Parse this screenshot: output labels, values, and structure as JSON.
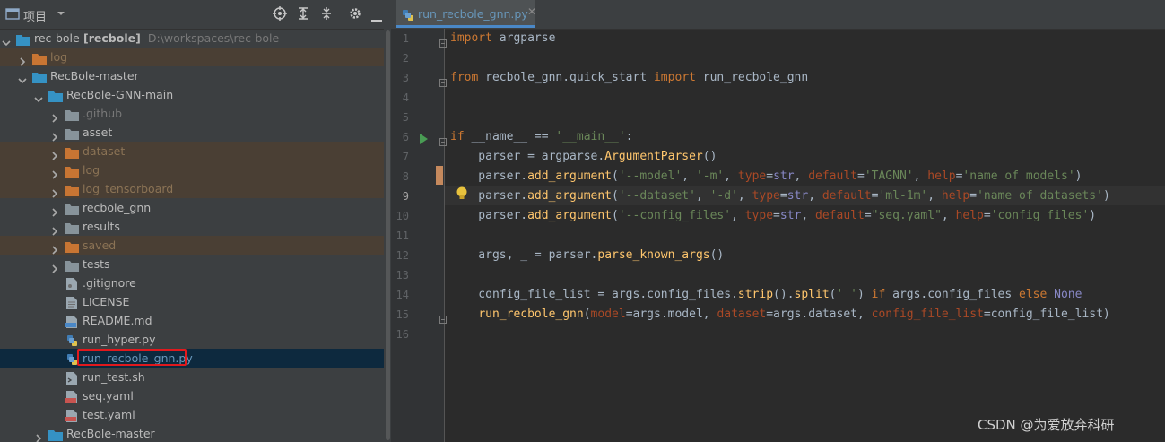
{
  "project_panel": {
    "title": "项目",
    "tree": [
      {
        "label": "rec-bole",
        "bold": "[recbole]",
        "path": "D:\\workspaces\\rec-bole",
        "depth": 0,
        "expanded": true,
        "type": "folder-blue"
      },
      {
        "label": "log",
        "depth": 1,
        "expanded": false,
        "type": "folder-orange",
        "excluded": true
      },
      {
        "label": "RecBole-master",
        "depth": 1,
        "expanded": true,
        "type": "folder-blue"
      },
      {
        "label": "RecBole-GNN-main",
        "depth": 2,
        "expanded": true,
        "type": "folder-blue"
      },
      {
        "label": ".github",
        "depth": 3,
        "expanded": false,
        "type": "folder-gray",
        "muted": true
      },
      {
        "label": "asset",
        "depth": 3,
        "expanded": false,
        "type": "folder-gray"
      },
      {
        "label": "dataset",
        "depth": 3,
        "expanded": false,
        "type": "folder-orange",
        "excluded": true
      },
      {
        "label": "log",
        "depth": 3,
        "expanded": false,
        "type": "folder-orange",
        "excluded": true
      },
      {
        "label": "log_tensorboard",
        "depth": 3,
        "expanded": false,
        "type": "folder-orange",
        "excluded": true
      },
      {
        "label": "recbole_gnn",
        "depth": 3,
        "expanded": false,
        "type": "folder-gray"
      },
      {
        "label": "results",
        "depth": 3,
        "expanded": false,
        "type": "folder-gray"
      },
      {
        "label": "saved",
        "depth": 3,
        "expanded": false,
        "type": "folder-orange",
        "excluded": true
      },
      {
        "label": "tests",
        "depth": 3,
        "expanded": false,
        "type": "folder-gray"
      },
      {
        "label": ".gitignore",
        "depth": 3,
        "type": "file-git"
      },
      {
        "label": "LICENSE",
        "depth": 3,
        "type": "file-text"
      },
      {
        "label": "README.md",
        "depth": 3,
        "type": "file-md"
      },
      {
        "label": "run_hyper.py",
        "depth": 3,
        "type": "file-py"
      },
      {
        "label": "run_recbole_gnn.py",
        "depth": 3,
        "type": "file-py",
        "selected": true
      },
      {
        "label": "run_test.sh",
        "depth": 3,
        "type": "file-sh"
      },
      {
        "label": "seq.yaml",
        "depth": 3,
        "type": "file-yaml"
      },
      {
        "label": "test.yaml",
        "depth": 3,
        "type": "file-yaml"
      },
      {
        "label": "RecBole-master",
        "depth": 2,
        "expanded": false,
        "type": "folder-blue"
      }
    ]
  },
  "editor": {
    "tab_label": "run_recbole_gnn.py",
    "tab_close": "✕",
    "caret_line": 9,
    "lines": [
      [
        [
          "kw",
          "import"
        ],
        [
          "plain",
          " argparse"
        ]
      ],
      [],
      [
        [
          "kw",
          "from"
        ],
        [
          "plain",
          " recbole_gnn.quick_start "
        ],
        [
          "kw",
          "import"
        ],
        [
          "plain",
          " run_recbole_gnn"
        ]
      ],
      [],
      [],
      [
        [
          "kw",
          "if"
        ],
        [
          "plain",
          " __name__ == "
        ],
        [
          "str",
          "'__main__'"
        ],
        [
          "plain",
          ":"
        ]
      ],
      [
        [
          "plain",
          "    parser = argparse."
        ],
        [
          "fn",
          "ArgumentParser"
        ],
        [
          "plain",
          "()"
        ]
      ],
      [
        [
          "plain",
          "    parser."
        ],
        [
          "fn",
          "add_argument"
        ],
        [
          "plain",
          "("
        ],
        [
          "str",
          "'--model'"
        ],
        [
          "plain",
          ", "
        ],
        [
          "str",
          "'-m'"
        ],
        [
          "plain",
          ", "
        ],
        [
          "kwarg",
          "type"
        ],
        [
          "plain",
          "="
        ],
        [
          "bi",
          "str"
        ],
        [
          "plain",
          ", "
        ],
        [
          "kwarg",
          "default"
        ],
        [
          "plain",
          "="
        ],
        [
          "str",
          "'TAGNN'"
        ],
        [
          "plain",
          ", "
        ],
        [
          "kwarg",
          "help"
        ],
        [
          "plain",
          "="
        ],
        [
          "str",
          "'name of models'"
        ],
        [
          "plain",
          ")"
        ]
      ],
      [
        [
          "plain",
          "    parser."
        ],
        [
          "fn",
          "add_argument"
        ],
        [
          "plain",
          "("
        ],
        [
          "str",
          "'--dataset'"
        ],
        [
          "plain",
          ", "
        ],
        [
          "str",
          "'-d'"
        ],
        [
          "plain",
          ", "
        ],
        [
          "kwarg",
          "type"
        ],
        [
          "plain",
          "="
        ],
        [
          "bi",
          "str"
        ],
        [
          "plain",
          ", "
        ],
        [
          "kwarg",
          "default"
        ],
        [
          "plain",
          "="
        ],
        [
          "str",
          "'ml-1m'"
        ],
        [
          "plain",
          ", "
        ],
        [
          "kwarg",
          "help"
        ],
        [
          "plain",
          "="
        ],
        [
          "str",
          "'name of datasets'"
        ],
        [
          "plain",
          ")"
        ]
      ],
      [
        [
          "plain",
          "    parser."
        ],
        [
          "fn",
          "add_argument"
        ],
        [
          "plain",
          "("
        ],
        [
          "str",
          "'--config_files'"
        ],
        [
          "plain",
          ", "
        ],
        [
          "kwarg",
          "type"
        ],
        [
          "plain",
          "="
        ],
        [
          "bi",
          "str"
        ],
        [
          "plain",
          ", "
        ],
        [
          "kwarg",
          "default"
        ],
        [
          "plain",
          "="
        ],
        [
          "str",
          "\"seq.yaml\""
        ],
        [
          "plain",
          ", "
        ],
        [
          "kwarg",
          "help"
        ],
        [
          "plain",
          "="
        ],
        [
          "str",
          "'config files'"
        ],
        [
          "plain",
          ")"
        ]
      ],
      [],
      [
        [
          "plain",
          "    args, _ = parser."
        ],
        [
          "fn",
          "parse_known_args"
        ],
        [
          "plain",
          "()"
        ]
      ],
      [],
      [
        [
          "plain",
          "    config_file_list = args.config_files."
        ],
        [
          "fn",
          "strip"
        ],
        [
          "plain",
          "()."
        ],
        [
          "fn",
          "split"
        ],
        [
          "plain",
          "("
        ],
        [
          "str",
          "' '"
        ],
        [
          "plain",
          ") "
        ],
        [
          "kw",
          "if"
        ],
        [
          "plain",
          " args.config_files "
        ],
        [
          "kw",
          "else"
        ],
        [
          "plain",
          " "
        ],
        [
          "bi",
          "None"
        ]
      ],
      [
        [
          "plain",
          "    "
        ],
        [
          "fn",
          "run_recbole_gnn"
        ],
        [
          "plain",
          "("
        ],
        [
          "kwarg",
          "model"
        ],
        [
          "plain",
          "=args.model, "
        ],
        [
          "kwarg",
          "dataset"
        ],
        [
          "plain",
          "=args.dataset, "
        ],
        [
          "kwarg",
          "config_file_list"
        ],
        [
          "plain",
          "=config_file_list)"
        ]
      ],
      []
    ]
  },
  "watermark": "CSDN @为爱放弃科研",
  "colors": {
    "accent": "#4a88c7",
    "highlight_box": "#e0191d",
    "excluded_bg": "#4a3f34"
  }
}
